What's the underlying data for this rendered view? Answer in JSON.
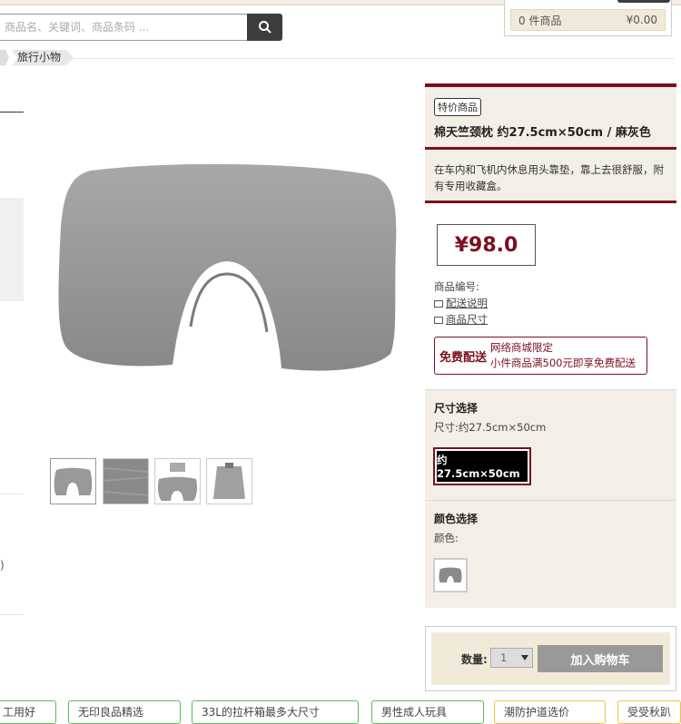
{
  "search": {
    "placeholder": "商品名、关键词、商品条码 ..."
  },
  "cart": {
    "count_label": "0 件商品",
    "total": "¥0.00"
  },
  "breadcrumb": {
    "current": "旅行小物"
  },
  "product": {
    "badge": "特价商品",
    "title": "棉天竺颈枕 约27.5cm×50cm / 麻灰色",
    "description": "在车内和飞机内休息用头靠垫，靠上去很舒服，附有专用收藏盒。",
    "price": "¥98.0",
    "code_label": "商品编号:",
    "shipping_link": "配送说明",
    "size_link": "商品尺寸",
    "free_shipping": {
      "title": "免费配送",
      "line1": "网络商城限定",
      "line2": "小件商品满500元即享免费配送"
    },
    "size_section": {
      "heading": "尺寸选择",
      "text": "尺寸:约27.5cm×50cm",
      "option": "约27.5cm×50cm"
    },
    "color_section": {
      "heading": "颜色选择",
      "text": "颜色:"
    }
  },
  "purchase": {
    "qty_label": "数量:",
    "qty_value": "1",
    "add_to_cart": "加入购物车"
  },
  "colors": {
    "accent": "#7b1020",
    "panel_bg": "#f3efe6",
    "pillow": "#9a9a9a"
  },
  "bottom_chips": [
    {
      "label": "工用好",
      "color": "#5cb85c"
    },
    {
      "label": "无印良品精选",
      "color": "#5cb85c"
    },
    {
      "label": "33L的拉杆箱最多大尺寸",
      "color": "#5cb85c"
    },
    {
      "label": "男性成人玩具",
      "color": "#5cb85c"
    },
    {
      "label": "潮防护道选价",
      "color": "#f0c040"
    },
    {
      "label": "受受秋趴",
      "color": "#f0c040"
    }
  ],
  "left_stub": {
    "paren": ")"
  }
}
